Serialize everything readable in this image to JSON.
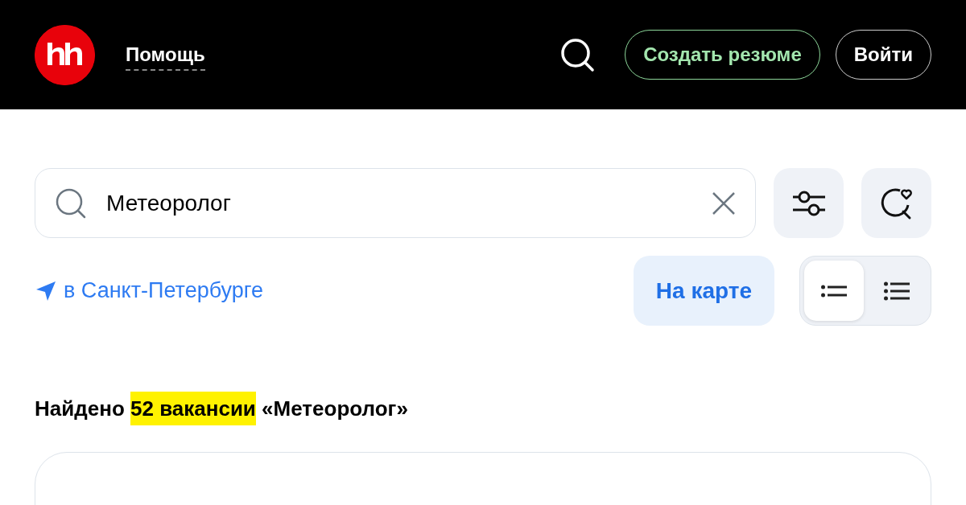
{
  "header": {
    "help_link": "Помощь",
    "buttons": [
      {
        "label": "Создать резюме",
        "kind": "outline-green"
      },
      {
        "label": "Войти",
        "kind": "outline"
      }
    ]
  },
  "search": {
    "value": "Метеоролог"
  },
  "location_link": "в Санкт-Петербурге",
  "map_button": "На карте",
  "view_modes": [
    {
      "kind": "short",
      "selected": true
    },
    {
      "kind": "long",
      "selected": false
    }
  ],
  "results_heading": {
    "prefix": "Найдено ",
    "highlighted": "52 вакансии",
    "suffix": " «Метеоролог»"
  }
}
